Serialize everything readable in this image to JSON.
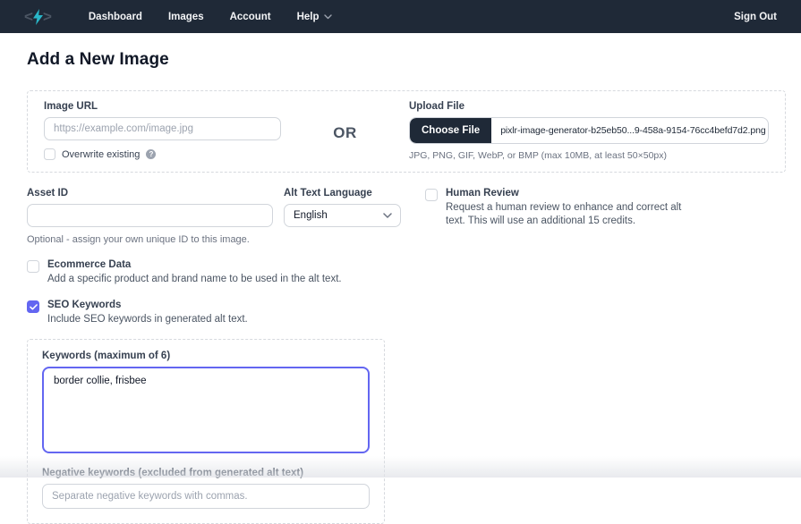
{
  "navbar": {
    "bg_color": "#1f2937",
    "brand": {
      "left_bracket": "<",
      "right_bracket": ">",
      "bolt_icon": "lightning-bolt-icon",
      "bolt_color": "#29b6c8"
    },
    "items": [
      {
        "label": "Dashboard"
      },
      {
        "label": "Images"
      },
      {
        "label": "Account"
      },
      {
        "label": "Help",
        "has_dropdown": true
      }
    ],
    "sign_out_label": "Sign Out"
  },
  "page": {
    "title": "Add a New Image"
  },
  "image_source": {
    "image_url": {
      "label": "Image URL",
      "value": "",
      "placeholder": "https://example.com/image.jpg"
    },
    "overwrite": {
      "label": "Overwrite existing",
      "checked": false,
      "help_icon_glyph": "?"
    },
    "or_divider": "OR",
    "upload": {
      "label": "Upload File",
      "choose_file_label": "Choose File",
      "filename": "pixlr-image-generator-b25eb50...9-458a-9154-76cc4befd7d2.png",
      "help_text": "JPG, PNG, GIF, WebP, or BMP (max 10MB, at least 50×50px)"
    }
  },
  "asset_id": {
    "label": "Asset ID",
    "value": "",
    "help_text": "Optional - assign your own unique ID to this image."
  },
  "language": {
    "label": "Alt Text Language",
    "selected": "English"
  },
  "human_review": {
    "label": "Human Review",
    "checked": false,
    "description": "Request a human review to enhance and correct alt text. This will use an additional 15 credits."
  },
  "ecommerce": {
    "label": "Ecommerce Data",
    "checked": false,
    "description": "Add a specific product and brand name to be used in the alt text."
  },
  "seo_keywords": {
    "label": "SEO Keywords",
    "checked": true,
    "accent_color": "#6366f1",
    "description": "Include SEO keywords in generated alt text."
  },
  "keywords_panel": {
    "keywords_label": "Keywords (maximum of 6)",
    "keywords_value": "border collie, frisbee",
    "negative_label": "Negative keywords (excluded from generated alt text)",
    "negative_value": "",
    "negative_placeholder": "Separate negative keywords with commas."
  }
}
